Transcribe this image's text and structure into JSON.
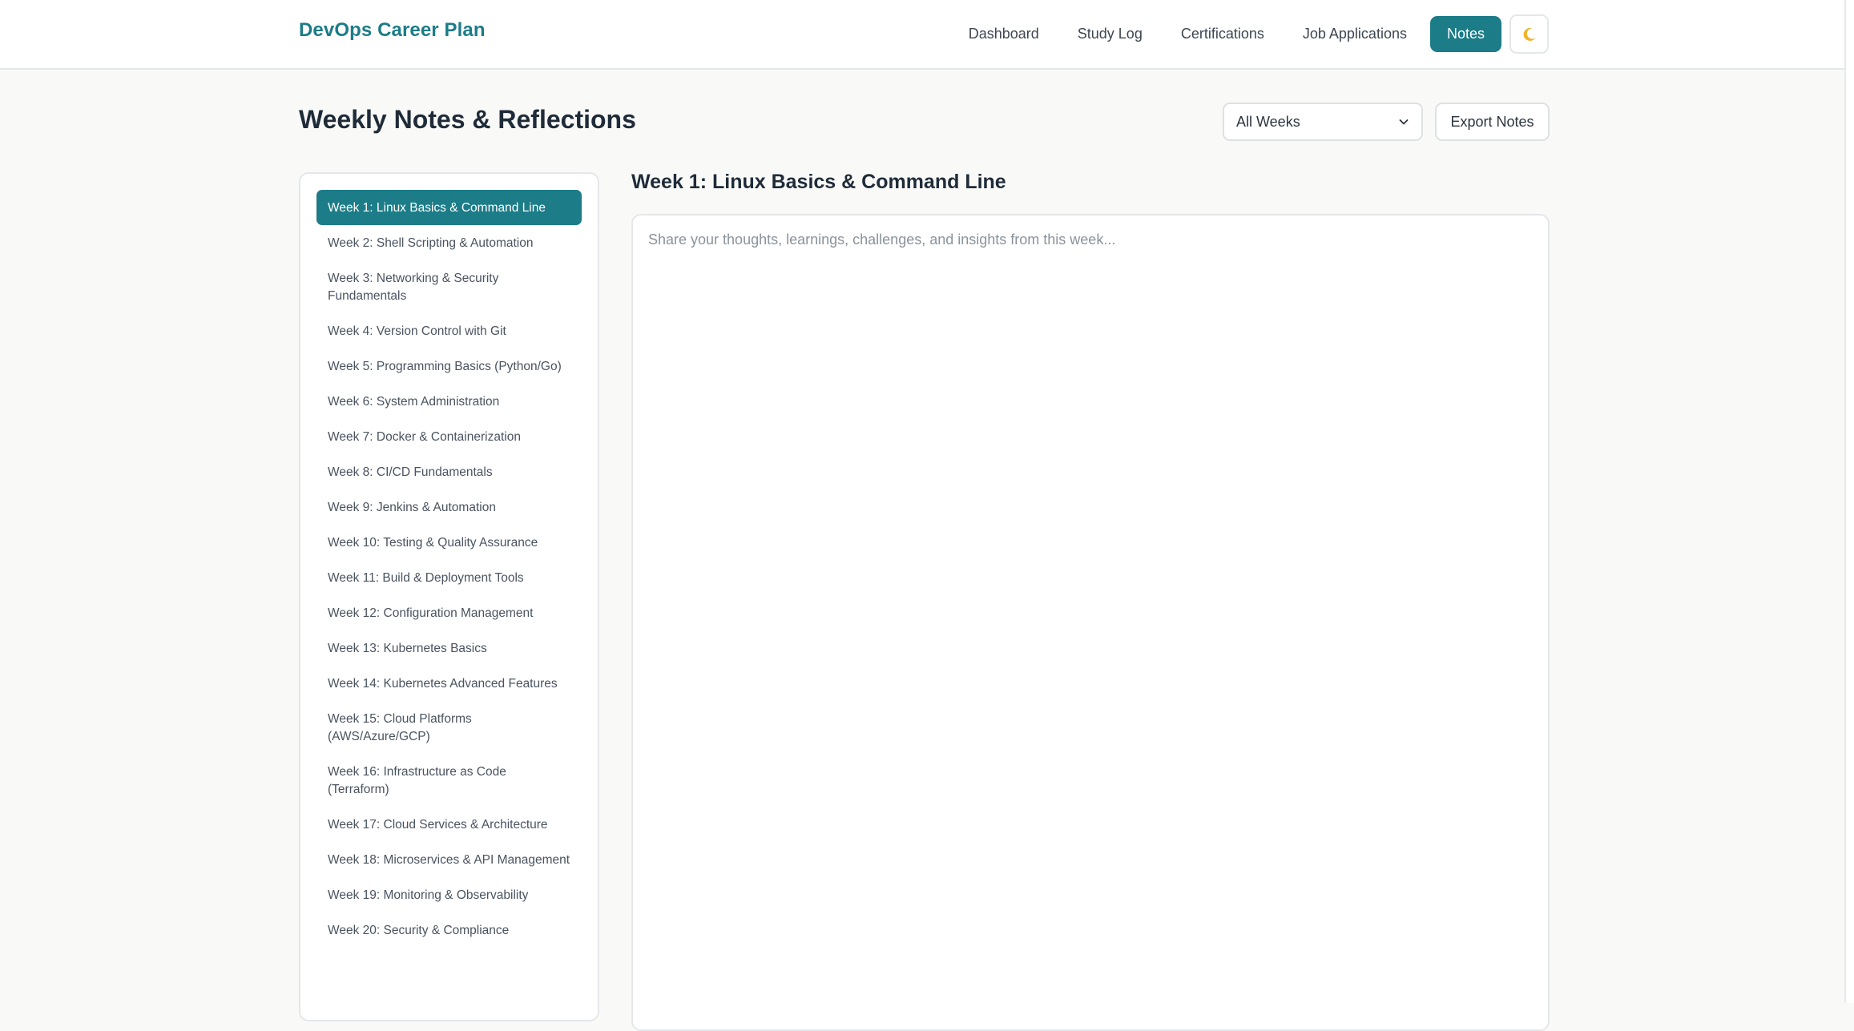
{
  "header": {
    "brand": "DevOps Career Plan",
    "nav": [
      {
        "label": "Dashboard",
        "active": false
      },
      {
        "label": "Study Log",
        "active": false
      },
      {
        "label": "Certifications",
        "active": false
      },
      {
        "label": "Job Applications",
        "active": false
      },
      {
        "label": "Notes",
        "active": true
      }
    ],
    "theme_toggle_icon": "moon-icon"
  },
  "page": {
    "title": "Weekly Notes & Reflections",
    "week_filter": {
      "selected": "All Weeks",
      "icon": "chevron-down-icon"
    },
    "export_label": "Export Notes"
  },
  "weeks": [
    {
      "label": "Week 1: Linux Basics & Command Line",
      "active": true
    },
    {
      "label": "Week 2: Shell Scripting & Automation"
    },
    {
      "label": "Week 3: Networking & Security Fundamentals"
    },
    {
      "label": "Week 4: Version Control with Git"
    },
    {
      "label": "Week 5: Programming Basics (Python/Go)"
    },
    {
      "label": "Week 6: System Administration"
    },
    {
      "label": "Week 7: Docker & Containerization"
    },
    {
      "label": "Week 8: CI/CD Fundamentals"
    },
    {
      "label": "Week 9: Jenkins & Automation"
    },
    {
      "label": "Week 10: Testing & Quality Assurance"
    },
    {
      "label": "Week 11: Build & Deployment Tools"
    },
    {
      "label": "Week 12: Configuration Management"
    },
    {
      "label": "Week 13: Kubernetes Basics"
    },
    {
      "label": "Week 14: Kubernetes Advanced Features"
    },
    {
      "label": "Week 15: Cloud Platforms (AWS/Azure/GCP)"
    },
    {
      "label": "Week 16: Infrastructure as Code (Terraform)"
    },
    {
      "label": "Week 17: Cloud Services & Architecture"
    },
    {
      "label": "Week 18: Microservices & API Management"
    },
    {
      "label": "Week 19: Monitoring & Observability"
    },
    {
      "label": "Week 20: Security & Compliance"
    }
  ],
  "editor": {
    "title": "Week 1: Linux Basics & Command Line",
    "value": "",
    "placeholder": "Share your thoughts, learnings, challenges, and insights from this week..."
  },
  "colors": {
    "accent": "#1c7c88",
    "background": "#f9faf8",
    "moon": "#f0b429"
  }
}
